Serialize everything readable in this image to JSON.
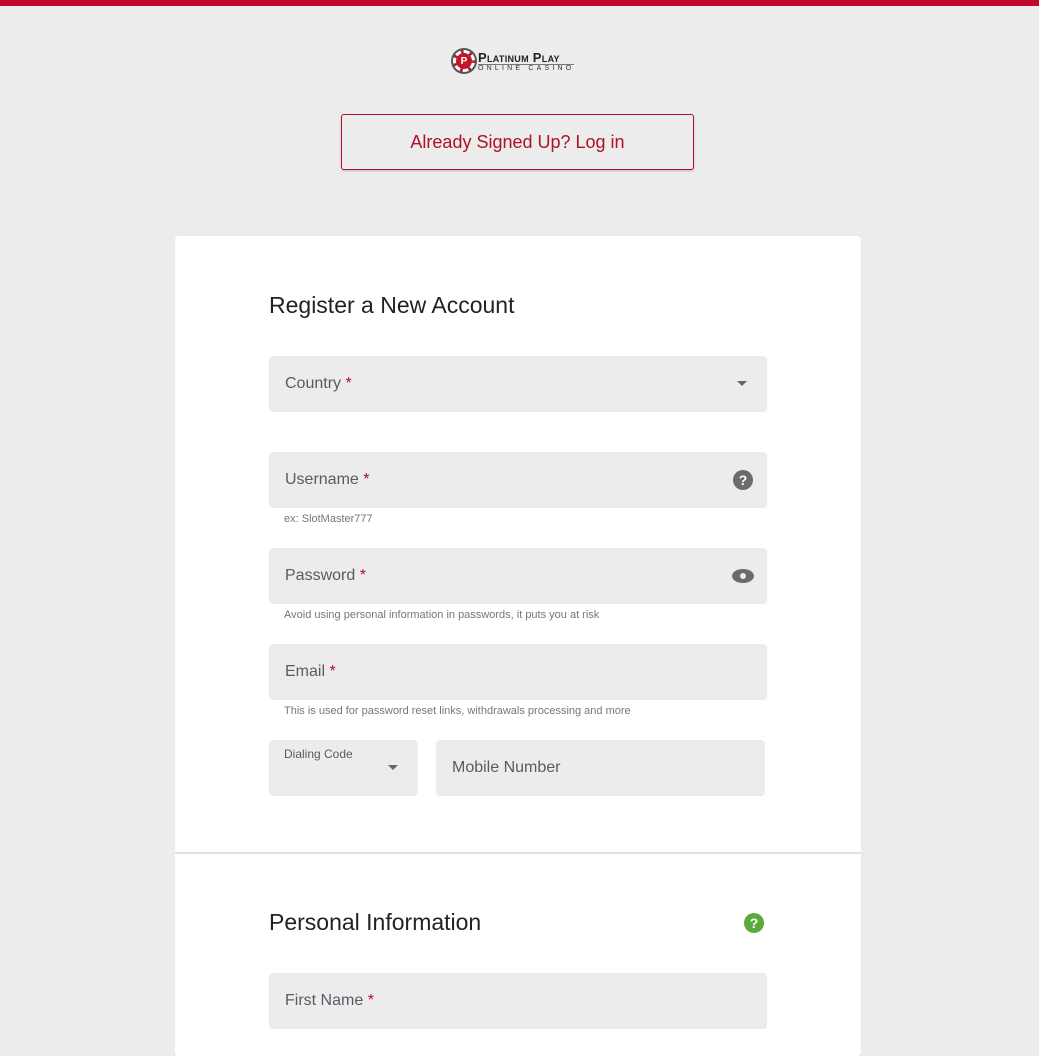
{
  "brand": {
    "line1": "Platinum Play",
    "line2": "ONLINE CASINO",
    "chip": "P"
  },
  "login_button": "Already Signed Up? Log in",
  "register": {
    "title": "Register a New Account",
    "country": {
      "label": "Country",
      "required": "*"
    },
    "username": {
      "label": "Username",
      "required": "*",
      "hint": "ex: SlotMaster777"
    },
    "password": {
      "label": "Password",
      "required": "*",
      "hint": "Avoid using personal information in passwords, it puts you at risk"
    },
    "email": {
      "label": "Email",
      "required": "*",
      "hint": "This is used for password reset links, withdrawals processing and more"
    },
    "dialing_code": {
      "label": "Dialing Code"
    },
    "mobile": {
      "placeholder": "Mobile Number"
    }
  },
  "personal": {
    "title": "Personal Information",
    "help": "?",
    "first_name": {
      "label": "First Name",
      "required": "*"
    }
  },
  "colors": {
    "accent": "#c0082a",
    "background": "#ececec",
    "help_green": "#5aab3c"
  }
}
